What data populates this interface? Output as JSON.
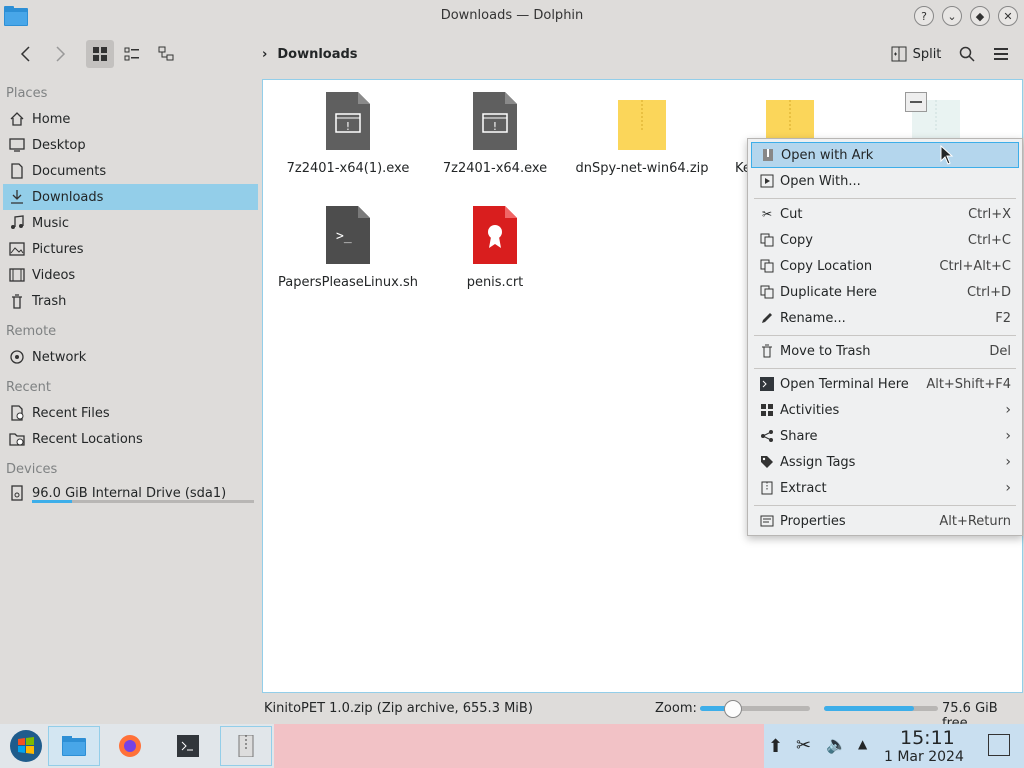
{
  "window": {
    "title": "Downloads — Dolphin",
    "buttons": [
      "help",
      "minimize",
      "maximize",
      "close"
    ]
  },
  "toolbar": {
    "breadcrumb": "Downloads",
    "split_label": "Split"
  },
  "sidebar": {
    "places_title": "Places",
    "places": [
      {
        "label": "Home",
        "icon": "home-icon"
      },
      {
        "label": "Desktop",
        "icon": "desktop-icon"
      },
      {
        "label": "Documents",
        "icon": "documents-icon"
      },
      {
        "label": "Downloads",
        "icon": "downloads-icon",
        "selected": true
      },
      {
        "label": "Music",
        "icon": "music-icon"
      },
      {
        "label": "Pictures",
        "icon": "pictures-icon"
      },
      {
        "label": "Videos",
        "icon": "videos-icon"
      },
      {
        "label": "Trash",
        "icon": "trash-icon"
      }
    ],
    "remote_title": "Remote",
    "remote": [
      {
        "label": "Network",
        "icon": "network-icon"
      }
    ],
    "recent_title": "Recent",
    "recent": [
      {
        "label": "Recent Files",
        "icon": "recent-files-icon"
      },
      {
        "label": "Recent Locations",
        "icon": "recent-locations-icon"
      }
    ],
    "devices_title": "Devices",
    "devices": [
      {
        "label": "96.0 GiB Internal Drive (sda1)",
        "icon": "drive-icon",
        "usage_fraction": 0.18
      }
    ]
  },
  "files": [
    {
      "name": "7z2401-x64(1).exe",
      "type": "exe"
    },
    {
      "name": "7z2401-x64.exe",
      "type": "exe"
    },
    {
      "name": "dnSpy-net-win64.zip",
      "type": "zip"
    },
    {
      "name": "Ke",
      "type": "zip"
    },
    {
      "name": "",
      "type": "zip-selected"
    },
    {
      "name": "PapersPleaseLinux.sh",
      "type": "sh"
    },
    {
      "name": "penis.crt",
      "type": "crt"
    }
  ],
  "context_menu": {
    "items": [
      {
        "label": "Open with Ark",
        "icon": "ark-icon",
        "shortcut": "",
        "highlighted": true
      },
      {
        "label": "Open With...",
        "icon": "open-with-icon",
        "shortcut": ""
      },
      {
        "label": "Cut",
        "icon": "scissors-icon",
        "shortcut": "Ctrl+X"
      },
      {
        "label": "Copy",
        "icon": "copy-icon",
        "shortcut": "Ctrl+C"
      },
      {
        "label": "Copy Location",
        "icon": "copy-location-icon",
        "shortcut": "Ctrl+Alt+C"
      },
      {
        "label": "Duplicate Here",
        "icon": "duplicate-icon",
        "shortcut": "Ctrl+D"
      },
      {
        "label": "Rename...",
        "icon": "rename-icon",
        "shortcut": "F2"
      },
      {
        "label": "Move to Trash",
        "icon": "trash-icon",
        "shortcut": "Del"
      },
      {
        "label": "Open Terminal Here",
        "icon": "terminal-icon",
        "shortcut": "Alt+Shift+F4"
      },
      {
        "label": "Activities",
        "icon": "activities-icon",
        "submenu": true
      },
      {
        "label": "Share",
        "icon": "share-icon",
        "submenu": true
      },
      {
        "label": "Assign Tags",
        "icon": "tag-icon",
        "submenu": true
      },
      {
        "label": "Extract",
        "icon": "extract-icon",
        "submenu": true
      },
      {
        "label": "Properties",
        "icon": "properties-icon",
        "shortcut": "Alt+Return"
      }
    ]
  },
  "statusbar": {
    "info": "KinitoPET 1.0.zip (Zip archive, 655.3 MiB)",
    "zoom_label": "Zoom:",
    "zoom_level": 0.3,
    "free_space": "75.6 GiB free",
    "free_fraction": 0.79
  },
  "taskbar": {
    "clock_time": "15:11",
    "clock_date": "1 Mar 2024"
  },
  "colors": {
    "accent": "#3daee9",
    "selection": "#93cee9",
    "zip": "#fbd65a",
    "exe": "#5f5f5f",
    "crt": "#d91e1e"
  }
}
